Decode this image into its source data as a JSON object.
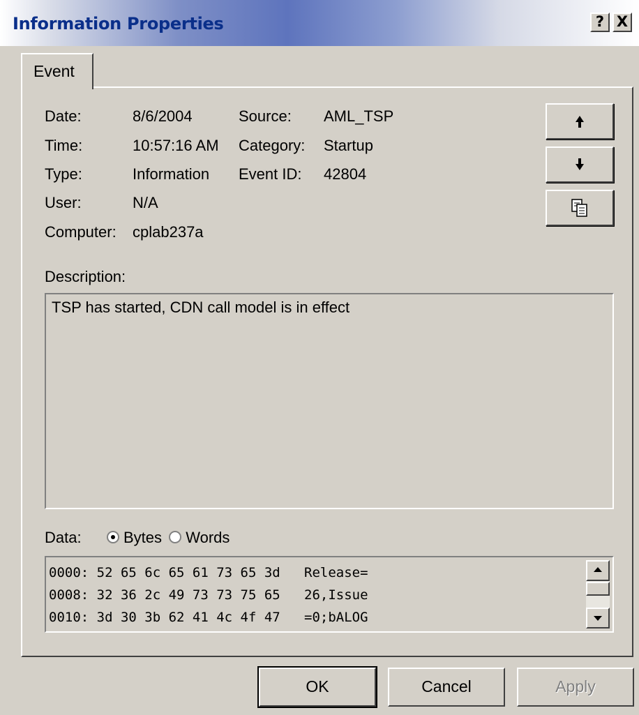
{
  "window": {
    "title": "Information Properties",
    "help_button": "?",
    "close_button": "X"
  },
  "tabs": [
    {
      "label": "Event",
      "active": true
    }
  ],
  "fields": {
    "date_label": "Date:",
    "date_value": "8/6/2004",
    "time_label": "Time:",
    "time_value": "10:57:16 AM",
    "type_label": "Type:",
    "type_value": "Information",
    "user_label": "User:",
    "user_value": "N/A",
    "computer_label": "Computer:",
    "computer_value": "cplab237a",
    "source_label": "Source:",
    "source_value": "AML_TSP",
    "category_label": "Category:",
    "category_value": "Startup",
    "event_id_label": "Event ID:",
    "event_id_value": "42804"
  },
  "nav_buttons": {
    "up_icon": "arrow-up-icon",
    "down_icon": "arrow-down-icon",
    "copy_icon": "copy-icon"
  },
  "description": {
    "label": "Description:",
    "text": "TSP has started, CDN call model is in effect"
  },
  "data": {
    "label": "Data:",
    "format_options": [
      "Bytes",
      "Words"
    ],
    "selected_format": "Bytes",
    "rows": [
      "0000: 52 65 6c 65 61 73 65 3d   Release=",
      "0008: 32 36 2c 49 73 73 75 65   26,Issue",
      "0010: 3d 30 3b 62 41 4c 4f 47   =0;bALOG"
    ]
  },
  "footer": {
    "ok": "OK",
    "cancel": "Cancel",
    "apply": "Apply"
  },
  "colors": {
    "dialog_face": "#d4d0c8",
    "title_text": "#0a2f8a"
  }
}
